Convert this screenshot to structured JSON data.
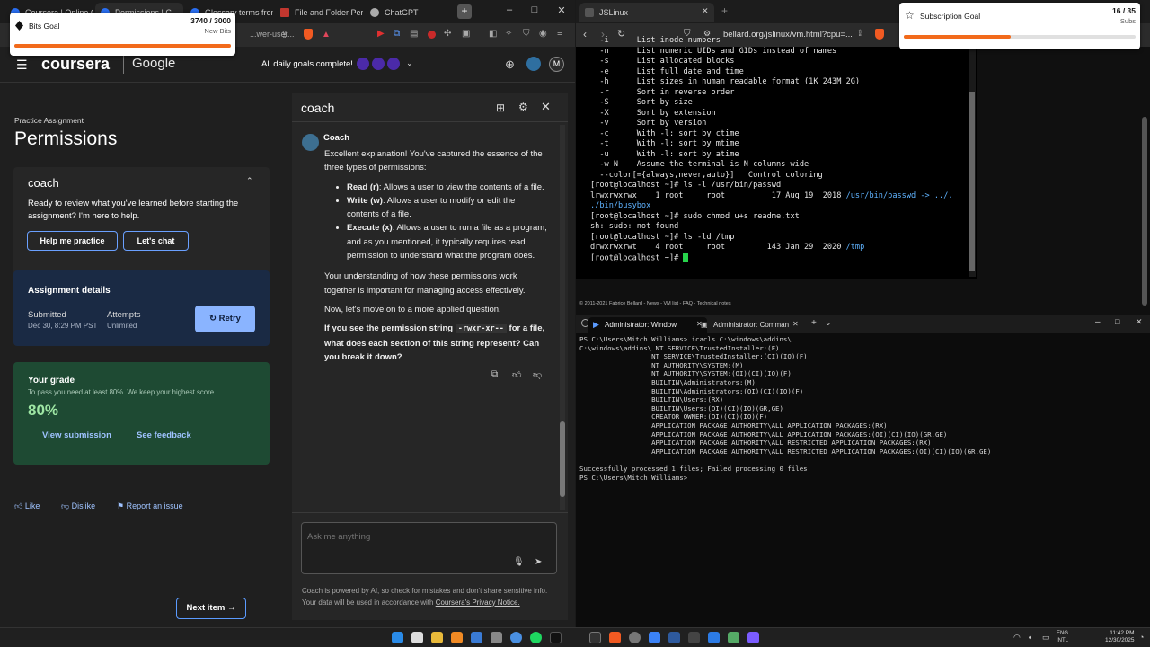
{
  "browser_left": {
    "tabs": [
      {
        "label": "Coursera | Online C...",
        "active": false
      },
      {
        "label": "Permissions | C...",
        "active": true
      },
      {
        "label": "Glossary terms from...",
        "active": false
      },
      {
        "label": "File and Folder Perm...",
        "active": false
      },
      {
        "label": "ChatGPT",
        "active": false
      }
    ],
    "url_fragment": "...wer-user..."
  },
  "coursera": {
    "logo": "coursera",
    "partner": "Google",
    "daily_goals": "All daily goals complete!",
    "user_initial": "M"
  },
  "assignment": {
    "kicker": "Practice Assignment",
    "title": "Permissions"
  },
  "coach_card": {
    "title": "coach",
    "text": "Ready to review what you've learned before starting the assignment? I'm here to help.",
    "help_button": "Help me practice",
    "chat_button": "Let's chat"
  },
  "details": {
    "heading": "Assignment details",
    "submitted_label": "Submitted",
    "submitted_value": "Dec 30, 8:29 PM PST",
    "attempts_label": "Attempts",
    "attempts_value": "Unlimited",
    "retry": "Retry"
  },
  "grade": {
    "heading": "Your grade",
    "sub": "To pass you need at least 80%. We keep your highest score.",
    "value": "80%",
    "view": "View submission",
    "feedback": "See feedback"
  },
  "reactions": {
    "like": "Like",
    "dislike": "Dislike",
    "report": "Report an issue"
  },
  "next_item": "Next item",
  "coach_panel": {
    "title": "coach",
    "sender": "Coach",
    "p1": "Excellent explanation! You've captured the essence of the three types of permissions:",
    "bullets": [
      {
        "term": "Read (r)",
        "desc": ": Allows a user to view the contents of a file."
      },
      {
        "term": "Write (w)",
        "desc": ": Allows a user to modify or edit the contents of a file."
      },
      {
        "term": "Execute (x)",
        "desc": ": Allows a user to run a file as a program, and as you mentioned, it typically requires read permission to understand what the program does."
      }
    ],
    "p2": "Your understanding of how these permissions work together is important for managing access effectively.",
    "p3": "Now, let's move on to a more applied question.",
    "q_pre": "If you see the permission string ",
    "q_code": "-rwxr-xr--",
    "q_post": " for a file, what does each section of this string represent? Can you break it down?",
    "input_placeholder": "Ask me anything",
    "footer": "Coach is powered by AI, so check for mistakes and don't share sensitive info. Your data will be used in accordance with ",
    "footer_link": "Coursera's Privacy Notice."
  },
  "goal_bits": {
    "title": "Bits Goal",
    "count": "3740 / 3000",
    "sub": "New Bits",
    "progress": 1.0
  },
  "goal_subs": {
    "title": "Subscription Goal",
    "count": "16 / 35",
    "sub": "Subs",
    "progress": 0.46
  },
  "browser_right": {
    "tab": "JSLinux",
    "url": "bellard.org/jslinux/vm.html?cpu=..."
  },
  "terminal_lines": [
    "  -i      List inode numbers",
    "  -n      List numeric UIDs and GIDs instead of names",
    "  -s      List allocated blocks",
    "  -e      List full date and time",
    "  -h      List sizes in human readable format (1K 243M 2G)",
    "  -r      Sort in reverse order",
    "  -S      Sort by size",
    "  -X      Sort by extension",
    "  -v      Sort by version",
    "  -c      With -l: sort by ctime",
    "  -t      With -l: sort by mtime",
    "  -u      With -l: sort by atime",
    "  -w N    Assume the terminal is N columns wide",
    "  --color[={always,never,auto}]   Control coloring",
    "[root@localhost ~]# ls -l /usr/bin/passwd",
    "lrwxrwxrwx    1 root     root          17 Aug 19  2018 /usr/bin/passwd -> ../.",
    "./bin/busybox",
    "[root@localhost ~]# sudo chmod u+s readme.txt",
    "sh: sudo: not found",
    "[root@localhost ~]# ls -ld /tmp",
    "drwxrwxrwt    4 root     root         143 Jan 29  2020 /tmp",
    "[root@localhost ~]# "
  ],
  "jslinux_footer": "© 2011-2021 Fabrice Bellard - News - VM list - FAQ - Technical notes",
  "ps_tabs": [
    "Administrator: Window",
    "Administrator: Comman"
  ],
  "ps_lines": [
    "PS C:\\Users\\Mitch Williams> icacls C:\\windows\\addins\\",
    "C:\\windows\\addins\\ NT SERVICE\\TrustedInstaller:(F)",
    "                  NT SERVICE\\TrustedInstaller:(CI)(IO)(F)",
    "                  NT AUTHORITY\\SYSTEM:(M)",
    "                  NT AUTHORITY\\SYSTEM:(OI)(CI)(IO)(F)",
    "                  BUILTIN\\Administrators:(M)",
    "                  BUILTIN\\Administrators:(OI)(CI)(IO)(F)",
    "                  BUILTIN\\Users:(RX)",
    "                  BUILTIN\\Users:(OI)(CI)(IO)(GR,GE)",
    "                  CREATOR OWNER:(OI)(CI)(IO)(F)",
    "                  APPLICATION PACKAGE AUTHORITY\\ALL APPLICATION PACKAGES:(RX)",
    "                  APPLICATION PACKAGE AUTHORITY\\ALL APPLICATION PACKAGES:(OI)(CI)(IO)(GR,GE)",
    "                  APPLICATION PACKAGE AUTHORITY\\ALL RESTRICTED APPLICATION PACKAGES:(RX)",
    "                  APPLICATION PACKAGE AUTHORITY\\ALL RESTRICTED APPLICATION PACKAGES:(OI)(CI)(IO)(GR,GE)",
    "",
    "Successfully processed 1 files; Failed processing 0 files",
    "PS C:\\Users\\Mitch Williams> "
  ],
  "tray": {
    "lang1": "ENG",
    "lang2": "INTL",
    "time": "11:42 PM",
    "date": "12/30/2025"
  },
  "colors": {
    "accent": "#f26a1b",
    "coursera_blue": "#5b9bff",
    "grade_green": "#1e4a33",
    "details_blue": "#1a2a44"
  }
}
